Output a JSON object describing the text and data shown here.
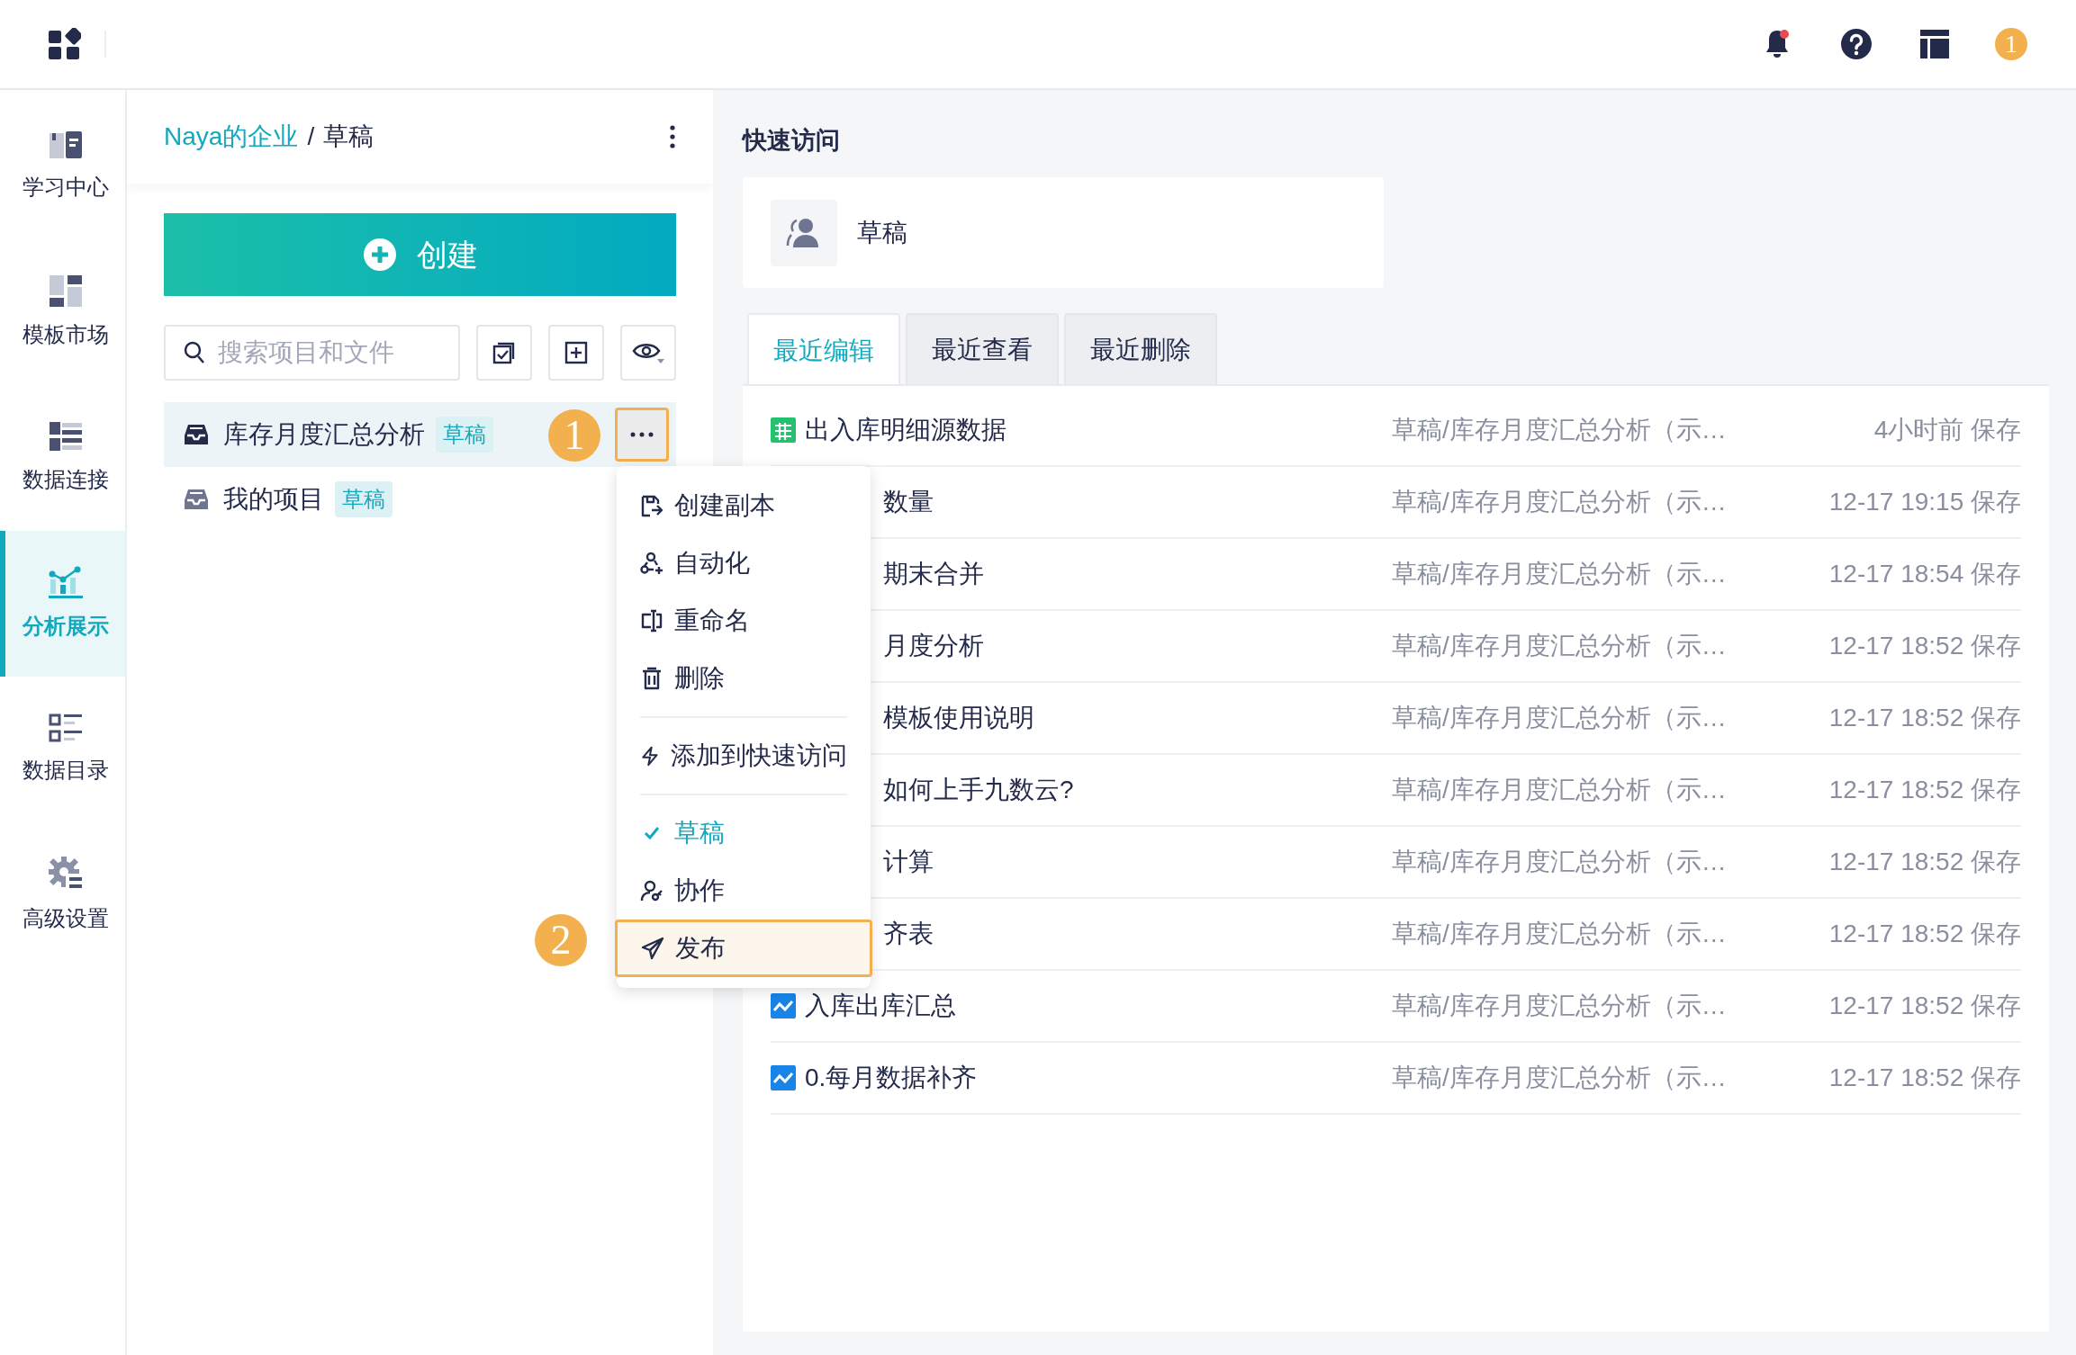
{
  "topbar": {
    "step_badge": "1"
  },
  "nav": [
    {
      "label": "学习中心",
      "selected": false
    },
    {
      "label": "模板市场",
      "selected": false
    },
    {
      "label": "数据连接",
      "selected": false
    },
    {
      "label": "分析展示",
      "selected": true
    },
    {
      "label": "数据目录",
      "selected": false
    },
    {
      "label": "高级设置",
      "selected": false
    }
  ],
  "breadcrumb": {
    "root": "Naya的企业",
    "separator": "/",
    "current": "草稿"
  },
  "create_button": "创建",
  "search": {
    "placeholder": "搜索项目和文件"
  },
  "projects": [
    {
      "name": "库存月度汇总分析",
      "tag": "草稿",
      "selected": true
    },
    {
      "name": "我的项目",
      "tag": "草稿",
      "selected": false
    }
  ],
  "callouts": [
    "1",
    "2"
  ],
  "menu": [
    [
      {
        "label": "创建副本",
        "checked": false,
        "selected": false
      },
      {
        "label": "自动化",
        "checked": false,
        "selected": false
      },
      {
        "label": "重命名",
        "checked": false,
        "selected": false
      },
      {
        "label": "删除",
        "checked": false,
        "selected": false
      }
    ],
    [
      {
        "label": "添加到快速访问",
        "checked": false,
        "selected": false
      }
    ],
    [
      {
        "label": "草稿",
        "checked": true,
        "selected": false
      },
      {
        "label": "协作",
        "checked": false,
        "selected": false
      },
      {
        "label": "发布",
        "checked": false,
        "selected": true
      }
    ]
  ],
  "quick_access": {
    "title": "快速访问",
    "items": [
      {
        "label": "草稿"
      }
    ]
  },
  "tabs": [
    {
      "label": "最近编辑",
      "selected": true
    },
    {
      "label": "最近查看",
      "selected": false
    },
    {
      "label": "最近删除",
      "selected": false
    }
  ],
  "files": [
    {
      "kind": "sheet",
      "name": "出入库明细源数据",
      "path": "草稿/库存月度汇总分析（示…",
      "time": "4小时前 保存"
    },
    {
      "kind": "covered",
      "name": "数量",
      "path": "草稿/库存月度汇总分析（示…",
      "time": "12-17 19:15 保存"
    },
    {
      "kind": "covered",
      "name": "期末合并",
      "path": "草稿/库存月度汇总分析（示…",
      "time": "12-17 18:54 保存"
    },
    {
      "kind": "covered",
      "name": "月度分析",
      "path": "草稿/库存月度汇总分析（示…",
      "time": "12-17 18:52 保存"
    },
    {
      "kind": "covered",
      "name": "模板使用说明",
      "path": "草稿/库存月度汇总分析（示…",
      "time": "12-17 18:52 保存"
    },
    {
      "kind": "covered",
      "name": "如何上手九数云?",
      "path": "草稿/库存月度汇总分析（示…",
      "time": "12-17 18:52 保存"
    },
    {
      "kind": "covered",
      "name": "计算",
      "path": "草稿/库存月度汇总分析（示…",
      "time": "12-17 18:52 保存"
    },
    {
      "kind": "covered",
      "name": "齐表",
      "path": "草稿/库存月度汇总分析（示…",
      "time": "12-17 18:52 保存"
    },
    {
      "kind": "chart",
      "name": "入库出库汇总",
      "path": "草稿/库存月度汇总分析（示…",
      "time": "12-17 18:52 保存"
    },
    {
      "kind": "chart",
      "name": "0.每月数据补齐",
      "path": "草稿/库存月度汇总分析（示…",
      "time": "12-17 18:52 保存"
    }
  ]
}
